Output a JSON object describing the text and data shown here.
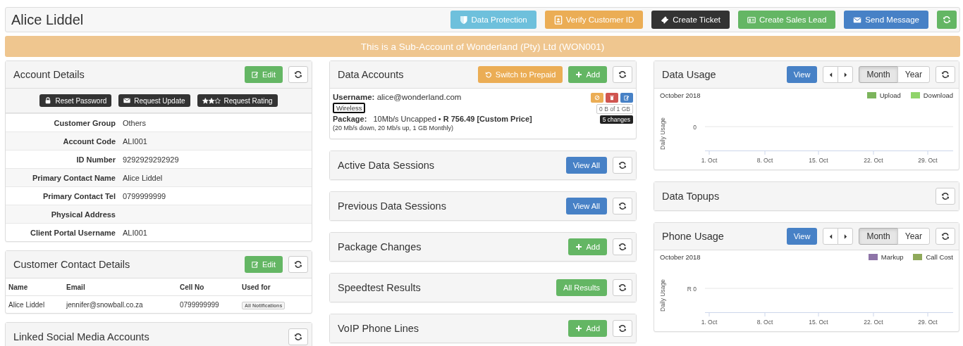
{
  "header": {
    "name": "Alice Liddel",
    "actions": [
      {
        "label": "Data Protection",
        "kind": "info"
      },
      {
        "label": "Verify Customer ID",
        "kind": "warning"
      },
      {
        "label": "Create Ticket",
        "kind": "dark"
      },
      {
        "label": "Create Sales Lead",
        "kind": "success"
      },
      {
        "label": "Send Message",
        "kind": "primary"
      }
    ]
  },
  "banner": "This is a Sub-Account of Wonderland (Pty) Ltd (WON001)",
  "account_details": {
    "title": "Account Details",
    "edit": "Edit",
    "actions": [
      "Reset Password",
      "Request Update",
      "Request Rating"
    ],
    "fields": [
      {
        "label": "Customer Group",
        "value": "Others"
      },
      {
        "label": "Account Code",
        "value": "ALI001"
      },
      {
        "label": "ID Number",
        "value": "9292929292929"
      },
      {
        "label": "Primary Contact Name",
        "value": "Alice Liddel"
      },
      {
        "label": "Primary Contact Tel",
        "value": "0799999999"
      },
      {
        "label": "Physical Address"
      },
      {
        "label": "Client Portal Username",
        "value": "ALI001"
      }
    ]
  },
  "contact_details": {
    "title": "Customer Contact Details",
    "edit": "Edit",
    "columns": [
      "Name",
      "Email",
      "Cell No",
      "Used for"
    ],
    "rows": [
      {
        "name": "Alice Liddel",
        "email": "jennifer@snowball.co.za",
        "cell": "0799999999",
        "used_for": "All Notifications"
      }
    ]
  },
  "social": {
    "title": "Linked Social Media Accounts"
  },
  "data_accounts": {
    "title": "Data Accounts",
    "switch": "Switch to Prepaid",
    "add": "Add",
    "account": {
      "username": "**Username:** alice@wonderland.com",
      "type": "Wireless",
      "package": "**Package:**   10Mb/s Uncapped • **R 756.49 [Custom Price]**",
      "details": "(20 Mb/s down, 20 Mb/s up, 1 GB Monthly)",
      "usage": "0 B of 1 GB",
      "changes": "5 changes"
    }
  },
  "panels": [
    {
      "title": "Active Data Sessions",
      "button": {
        "label": "View All",
        "kind": "view"
      }
    },
    {
      "title": "Previous Data Sessions",
      "button": {
        "label": "View All",
        "kind": "view"
      }
    },
    {
      "title": "Package Changes",
      "button": {
        "label": "Add",
        "kind": "add"
      }
    },
    {
      "title": "Speedtest Results",
      "button": {
        "label": "All Results",
        "kind": "results"
      }
    },
    {
      "title": "VoIP Phone Lines",
      "button": {
        "label": "Add",
        "kind": "add"
      }
    }
  ],
  "usage": [
    {
      "title": "Data Usage",
      "view": "View",
      "periods": [
        {
          "label": "Month",
          "selected": true
        },
        {
          "label": "Year",
          "selected": false
        }
      ],
      "month": "October 2018",
      "legend": [
        {
          "label": "Upload",
          "color": "#7cb45c"
        },
        {
          "label": "Download",
          "color": "#90d46a"
        }
      ],
      "ylabel": "Daily Usage",
      "ytick": "0",
      "xticks": [
        "1. Oct",
        "8. Oct",
        "15. Oct",
        "22. Oct",
        "29. Oct"
      ]
    },
    {
      "title": "Phone Usage",
      "view": "View",
      "periods": [
        {
          "label": "Month",
          "selected": true
        },
        {
          "label": "Year",
          "selected": false
        }
      ],
      "month": "October 2018",
      "legend": [
        {
          "label": "Markup",
          "color": "#8e74a8"
        },
        {
          "label": "Call Cost",
          "color": "#8fa95a"
        }
      ],
      "ylabel": "Daily Usage",
      "ytick": "R 0",
      "xticks": [
        "1. Oct",
        "8. Oct",
        "15. Oct",
        "22. Oct",
        "29. Oct"
      ]
    }
  ],
  "topups": {
    "title": "Data Topups"
  }
}
